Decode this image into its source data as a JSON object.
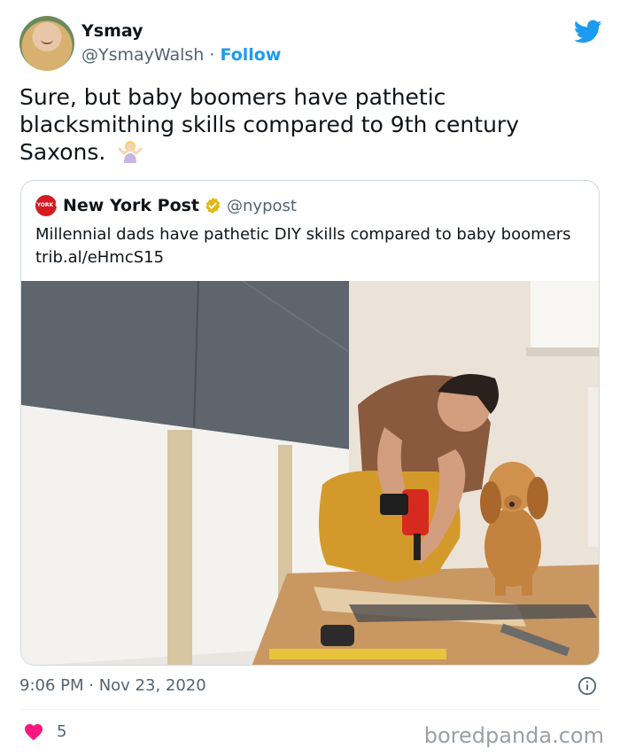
{
  "tweet": {
    "author_name": "Ysmay",
    "author_handle": "@YsmayWalsh",
    "separator": "·",
    "follow_label": "Follow",
    "text": "Sure, but baby boomers have pathetic blacksmithing skills compared to 9th century Saxons.",
    "emoji": "person-shrugging-emoji",
    "timestamp": "9:06 PM · Nov 23, 2020",
    "like_count": "5"
  },
  "quoted_tweet": {
    "logo_text": "NEW YORK POST",
    "author_name": "New York Post",
    "author_handle": "@nypost",
    "text": "Millennial dads have pathetic DIY skills compared to baby boomers trib.al/eHmcS15"
  },
  "watermark": "boredpanda.com",
  "colors": {
    "twitter_blue": "#1d9bf0",
    "text_primary": "#0f1419",
    "text_secondary": "#536471",
    "like_red": "#f91880",
    "verified_gold": "#e2b719",
    "border": "#cfd9de"
  },
  "icons": [
    "twitter-bird-icon",
    "verified-badge-icon",
    "info-icon",
    "heart-icon"
  ]
}
